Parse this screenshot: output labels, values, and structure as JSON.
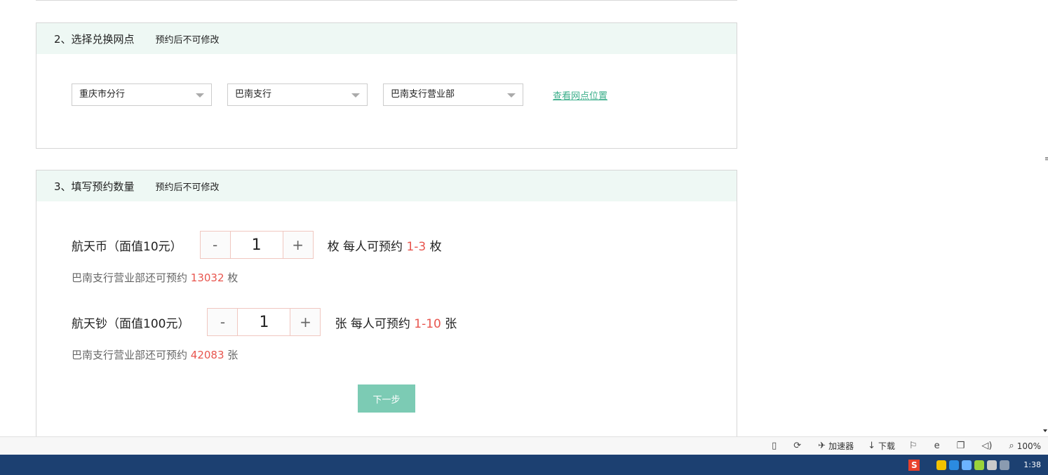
{
  "section2": {
    "title": "2、选择兑换网点",
    "note": "预约后不可修改",
    "selects": [
      "重庆市分行",
      "巴南支行",
      "巴南支行营业部"
    ],
    "map_link": "查看网点位置"
  },
  "section3": {
    "title": "3、填写预约数量",
    "note": "预约后不可修改",
    "items": [
      {
        "label": "航天币（面值10元）",
        "quantity": "1",
        "unit": "枚",
        "limit_prefix": "每人可预约",
        "limit": "1-3",
        "remain_prefix": "巴南支行营业部还可预约",
        "remain": "13032",
        "remain_unit": "枚"
      },
      {
        "label": "航天钞（面值100元）",
        "quantity": "1",
        "unit": "张",
        "limit_prefix": "每人可预约",
        "limit": "1-10",
        "remain_prefix": "巴南支行营业部还可预约",
        "remain": "42083",
        "remain_unit": "张"
      }
    ],
    "minus": "-",
    "plus": "+",
    "next_button": "下一步"
  },
  "status_bar": {
    "accelerator": "加速器",
    "download": "下载",
    "zoom": "100%"
  },
  "taskbar": {
    "clock": "1:38",
    "ime": "S"
  },
  "colors": {
    "accent_green": "#7ccbb4",
    "link_green": "#3bae8a",
    "highlight_red": "#e8554e",
    "header_bg": "#eef8f4",
    "taskbar_bg": "#1c4071"
  }
}
